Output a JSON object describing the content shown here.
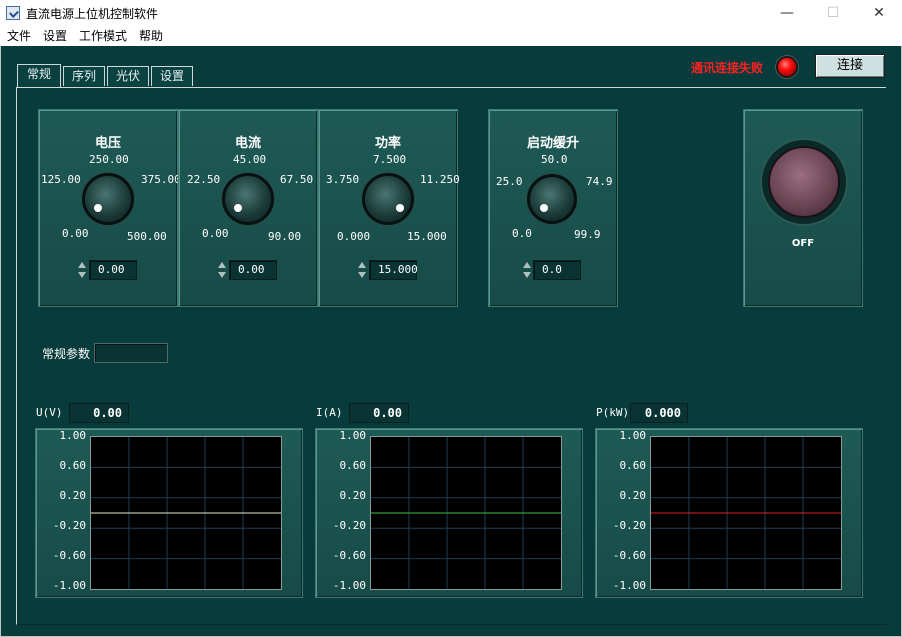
{
  "window": {
    "title": "直流电源上位机控制软件",
    "minimize": "—",
    "maximize": "☐",
    "close": "✕"
  },
  "menu": [
    "文件",
    "设置",
    "工作模式",
    "帮助"
  ],
  "tabs": [
    "常规",
    "序列",
    "光伏",
    "设置"
  ],
  "status": {
    "text": "通讯连接失败",
    "led_color": "#ff1010"
  },
  "connect_label": "连接",
  "knobs": [
    {
      "title": "电压",
      "labels": {
        "top": "250.00",
        "upper_left": "125.00",
        "upper_right": "375.00",
        "lower_left": "0.00",
        "lower_right": "500.00"
      },
      "value": "0.00"
    },
    {
      "title": "电流",
      "labels": {
        "top": "45.00",
        "upper_left": "22.50",
        "upper_right": "67.50",
        "lower_left": "0.00",
        "lower_right": "90.00"
      },
      "value": "0.00"
    },
    {
      "title": "功率",
      "labels": {
        "top": "7.500",
        "upper_left": "3.750",
        "upper_right": "11.250",
        "lower_left": "0.000",
        "lower_right": "15.000"
      },
      "value": "15.000"
    },
    {
      "title": "启动缓升",
      "labels": {
        "top": "50.0",
        "upper_left": "25.0",
        "upper_right": "74.9",
        "lower_left": "0.0",
        "lower_right": "99.9"
      },
      "value": "0.0"
    }
  ],
  "power": {
    "label": "OFF"
  },
  "params": {
    "label": "常规参数",
    "value": ""
  },
  "graphs": [
    {
      "label": "U(V)",
      "value": "0.00",
      "line_color": "#e8e8c8"
    },
    {
      "label": "I(A)",
      "value": "0.00",
      "line_color": "#3fbf3f"
    },
    {
      "label": "P(kW)",
      "value": "0.000",
      "line_color": "#e02020"
    }
  ],
  "y_ticks": [
    "1.00",
    "0.60",
    "0.20",
    "-0.20",
    "-0.60",
    "-1.00"
  ]
}
